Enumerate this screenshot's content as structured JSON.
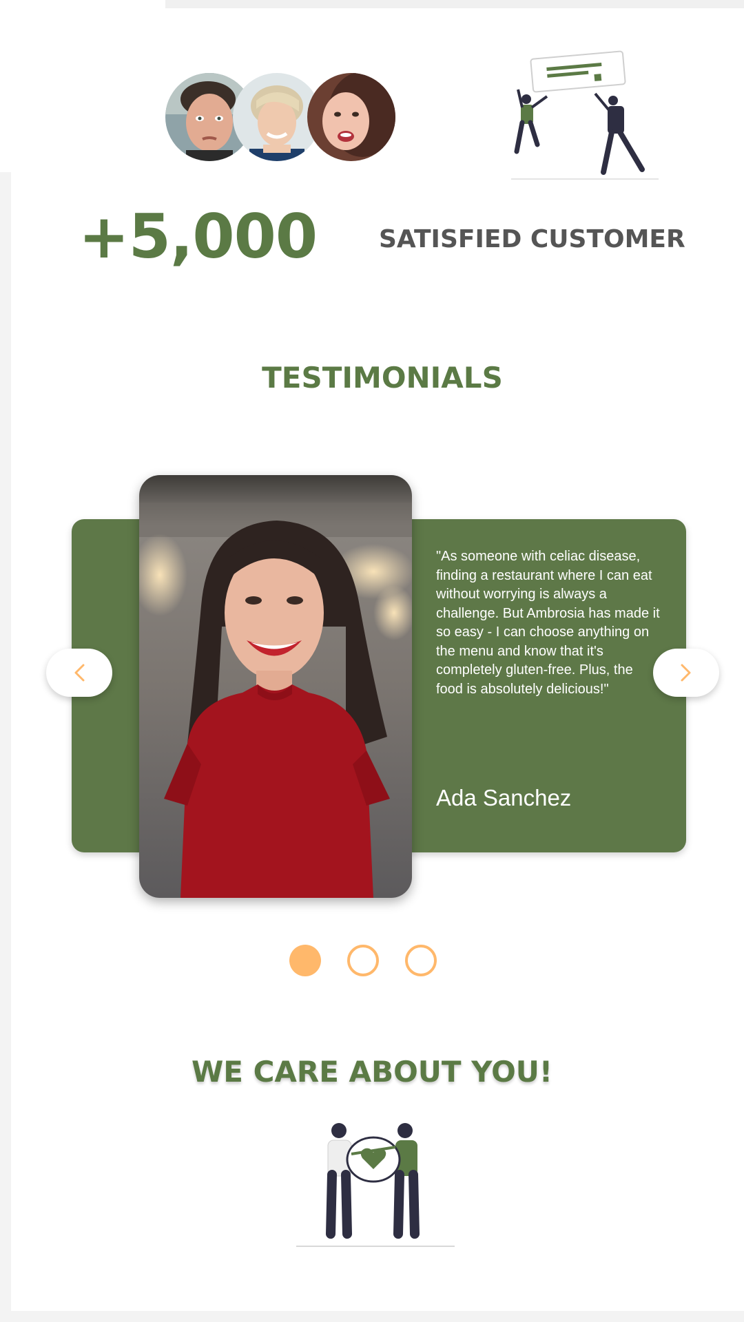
{
  "stats": {
    "count": "+5,000",
    "label": "SATISFIED CUSTOMER"
  },
  "testimonials": {
    "title": "TESTIMONIALS",
    "quote": "\"As someone with celiac disease, finding a restaurant where I can eat without worrying is always a challenge. But Ambrosia has made it so easy - I can choose anything on the menu and know that it's completely gluten-free. Plus, the food is absolutely delicious!\"",
    "author": "Ada Sanchez",
    "prev_icon": "chevron-left-icon",
    "next_icon": "chevron-right-icon",
    "active_slide": 1,
    "slide_count": 3
  },
  "care": {
    "title": "WE CARE ABOUT YOU!"
  },
  "colors": {
    "brand_green": "#5e7848",
    "accent_orange": "#ffb86b",
    "text_gray": "#555555"
  }
}
